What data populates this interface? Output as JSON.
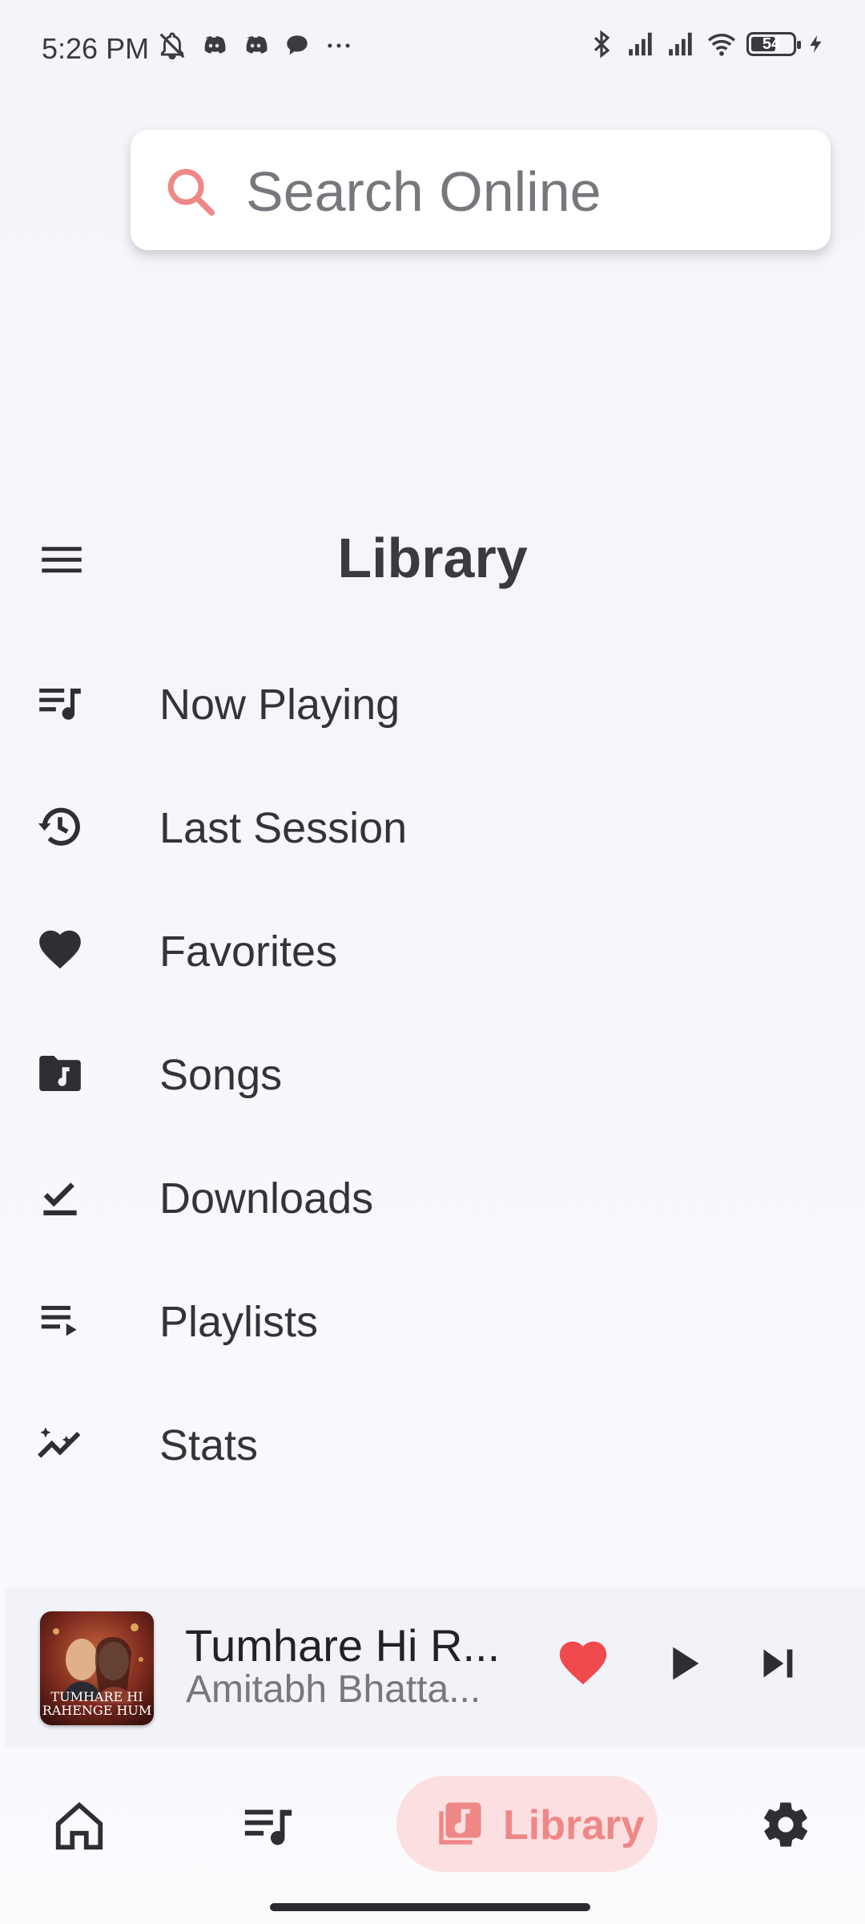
{
  "status_bar": {
    "time": "5:26 PM",
    "battery": "54"
  },
  "search": {
    "placeholder": "Search Online"
  },
  "header": {
    "title": "Library"
  },
  "library_items": [
    {
      "label": "Now Playing",
      "icon": "queue-music-icon"
    },
    {
      "label": "Last Session",
      "icon": "history-icon"
    },
    {
      "label": "Favorites",
      "icon": "heart-icon"
    },
    {
      "label": "Songs",
      "icon": "music-folder-icon"
    },
    {
      "label": "Downloads",
      "icon": "download-done-icon"
    },
    {
      "label": "Playlists",
      "icon": "playlist-play-icon"
    },
    {
      "label": "Stats",
      "icon": "insights-icon"
    }
  ],
  "mini_player": {
    "title": "Tumhare Hi R...",
    "artist": "Amitabh Bhatta...",
    "album_art_text": "TUMHARE HI RAHENGE HUM",
    "favorite": true
  },
  "bottom_nav": {
    "active_label": "Library",
    "items": [
      "home-icon",
      "queue-music-icon",
      "library-music-icon",
      "settings-icon"
    ]
  },
  "colors": {
    "accent": "#ef8787",
    "accent_bg": "#fce0e1",
    "heart": "#f04a4f"
  }
}
